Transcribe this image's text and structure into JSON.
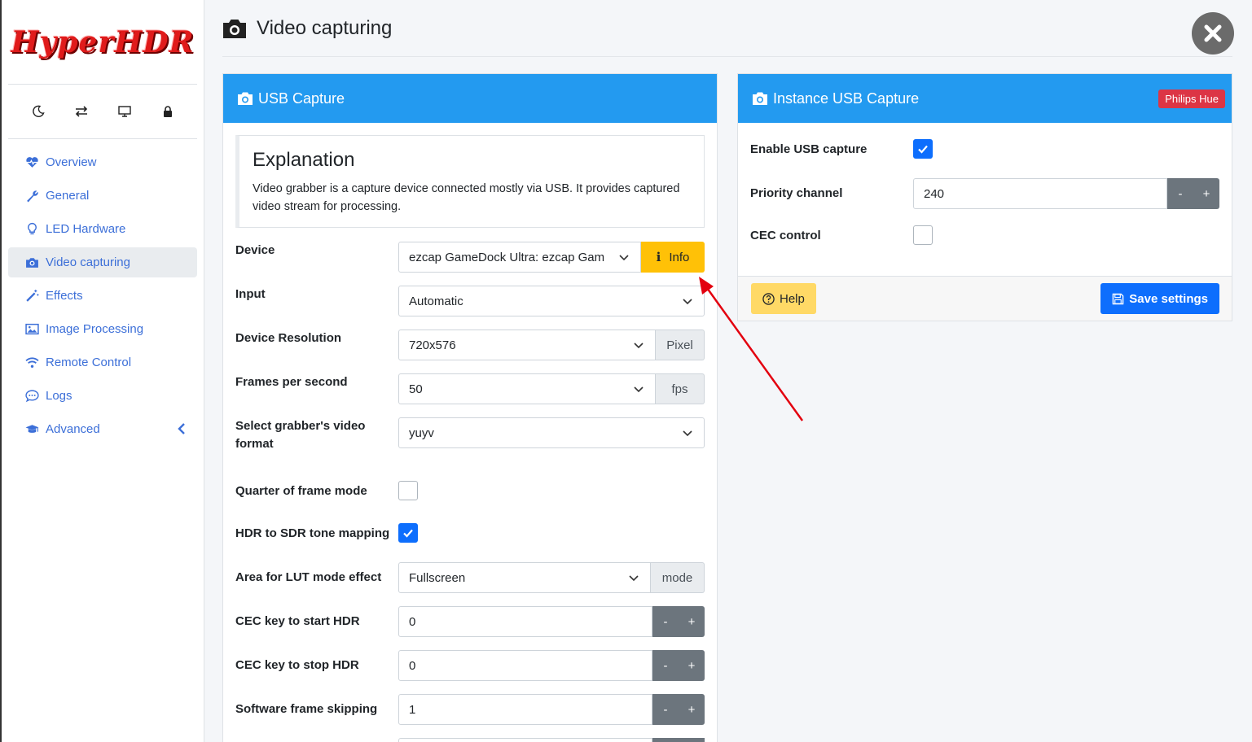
{
  "app": {
    "logo_text": "HyperHDR"
  },
  "quickbar": {
    "icons": [
      "moon-icon",
      "swap-icon",
      "monitor-icon",
      "lock-icon"
    ]
  },
  "sidebar": {
    "items": [
      {
        "label": "Overview",
        "icon": "heartbeat-icon"
      },
      {
        "label": "General",
        "icon": "wrench-icon"
      },
      {
        "label": "LED Hardware",
        "icon": "lightbulb-icon"
      },
      {
        "label": "Video capturing",
        "icon": "camera-icon",
        "active": true
      },
      {
        "label": "Effects",
        "icon": "magic-wand-icon"
      },
      {
        "label": "Image Processing",
        "icon": "image-icon"
      },
      {
        "label": "Remote Control",
        "icon": "wifi-icon"
      },
      {
        "label": "Logs",
        "icon": "chat-icon"
      },
      {
        "label": "Advanced",
        "icon": "graduation-cap-icon"
      }
    ]
  },
  "header": {
    "title": "Video capturing"
  },
  "usb_card": {
    "title": "USB Capture",
    "explain_title": "Explanation",
    "explain_text": "Video grabber is a capture device connected mostly via USB. It provides captured video stream for processing.",
    "rows": {
      "device": {
        "label": "Device",
        "value": "ezcap GameDock Ultra: ezcap Gam",
        "button": "Info"
      },
      "input": {
        "label": "Input",
        "value": "Automatic"
      },
      "resolution": {
        "label": "Device Resolution",
        "value": "720x576",
        "unit": "Pixel"
      },
      "fps": {
        "label": "Frames per second",
        "value": "50",
        "unit": "fps"
      },
      "format": {
        "label": "Select grabber's video format",
        "value": "yuyv"
      },
      "quarter": {
        "label": "Quarter of frame mode",
        "checked": false
      },
      "hdr": {
        "label": "HDR to SDR tone mapping",
        "checked": true
      },
      "lut_area": {
        "label": "Area for LUT mode effect",
        "value": "Fullscreen",
        "unit": "mode"
      },
      "cec_start": {
        "label": "CEC key to start HDR",
        "value": "0"
      },
      "cec_stop": {
        "label": "CEC key to stop HDR",
        "value": "0"
      },
      "frame_skip": {
        "label": "Software frame skipping",
        "value": "1"
      }
    },
    "minus": "-",
    "plus": "+"
  },
  "instance_card": {
    "title": "Instance USB Capture",
    "badge": "Philips Hue",
    "rows": {
      "enable": {
        "label": "Enable USB capture",
        "checked": true
      },
      "priority": {
        "label": "Priority channel",
        "value": "240"
      },
      "cec": {
        "label": "CEC control",
        "checked": false
      }
    },
    "help_label": "Help",
    "save_label": "Save settings"
  },
  "colors": {
    "accent": "#239af0",
    "nav_text": "#3c6fd8",
    "warning": "#ffc107",
    "danger": "#dc3545",
    "primary": "#0d6efd",
    "annotation": "#e3000f"
  }
}
